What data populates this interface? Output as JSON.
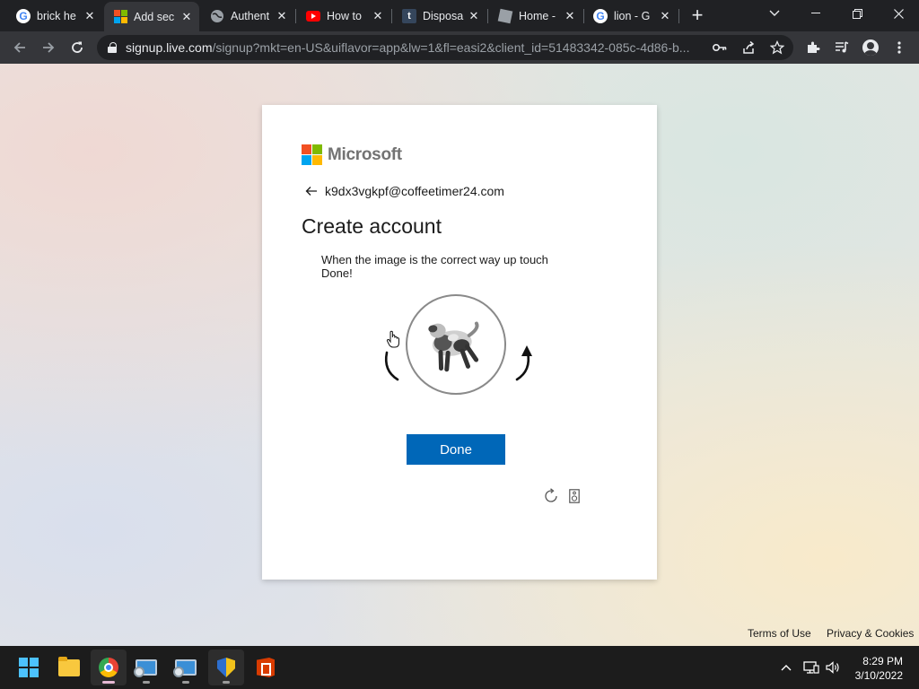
{
  "browser": {
    "tabs": [
      {
        "title": "brick he",
        "favicon": "google-icon"
      },
      {
        "title": "Add sec",
        "favicon": "microsoft-icon"
      },
      {
        "title": "Authent",
        "favicon": "globe-icon"
      },
      {
        "title": "How to",
        "favicon": "youtube-icon"
      },
      {
        "title": "Disposa",
        "favicon": "tumblr-icon"
      },
      {
        "title": "Home -",
        "favicon": "home-icon"
      },
      {
        "title": "lion - G",
        "favicon": "google-icon"
      }
    ],
    "active_tab": 1,
    "url_host": "signup.live.com",
    "url_path": "/signup?mkt=en-US&uiflavor=app&lw=1&fl=easi2&client_id=51483342-085c-4d86-b..."
  },
  "signin": {
    "brand": "Microsoft",
    "identity": "k9dx3vgkpf@coffeetimer24.com",
    "title": "Create account",
    "instruction": "When the image is the correct way up touch Done!",
    "done_label": "Done"
  },
  "footer": {
    "terms": "Terms of Use",
    "privacy": "Privacy & Cookies"
  },
  "taskbar": {
    "apps": [
      "windows-start",
      "file-explorer",
      "chrome",
      "remote-desktop",
      "remote-desktop-2",
      "windows-security",
      "office"
    ],
    "time": "8:29 PM",
    "date": "3/10/2022"
  },
  "colors": {
    "accent": "#0067b8",
    "ms_red": "#f25022",
    "ms_green": "#7fba00",
    "ms_blue": "#00a4ef",
    "ms_yellow": "#ffb900"
  }
}
